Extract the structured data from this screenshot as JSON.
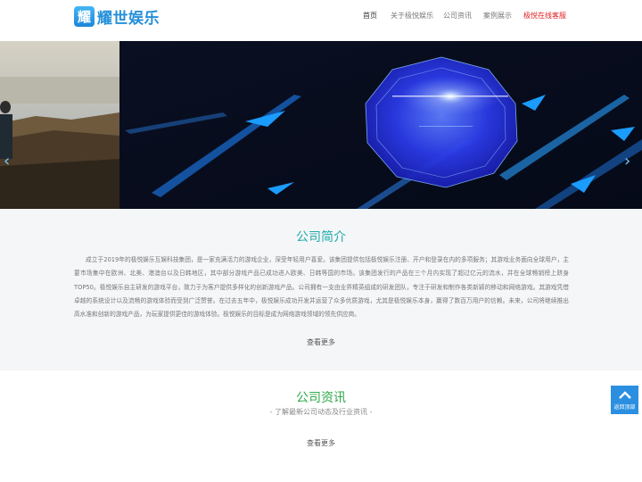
{
  "header": {
    "logo_mark": "耀",
    "logo_text": "耀世娱乐",
    "nav": [
      "首页",
      "关于极悦娱乐",
      "公司资讯",
      "案例展示",
      "极悦在线客服"
    ]
  },
  "banner": {
    "prev": "‹",
    "next": "›"
  },
  "about": {
    "title": "公司简介",
    "body": "成立于2019年的极悦娱乐互娱科技集团，是一家充满活力的游戏企业，深受年轻用户喜爱。该集团提供包括极悦娱乐注册、开户和登录在内的多项服务；其游戏业务面向全球用户，主要市场集中在欧洲、北美、港澳台以及日韩地区，其中部分游戏产品已成功进入欧美、日韩等国的市场。该集团发行的产品在三个月内实现了超过亿元的流水，并在全球畅销榜上跻身TOP50。极悦娱乐自主研发的游戏平台，致力于为客户提供多样化的创新游戏产品。公司拥有一支由业界精英组成的研发团队，专注于研发和制作各类新颖的移动和网络游戏。其游戏凭借卓越的系统设计以及流畅的游戏体验而受到广泛赞誉。在过去五年中，极悦娱乐成功开发并运营了众多优质游戏，尤其是极悦娱乐本身，赢得了数百万用户的信赖。未来，公司将继续推出高水准和创新的游戏产品，为玩家提供更佳的游戏体验。极悦娱乐的目标是成为网络游戏领域的领先供应商。",
    "more": "查看更多"
  },
  "news": {
    "title": "公司资讯",
    "subtitle": "- 了解最新公司动态及行业资讯 -",
    "more": "查看更多"
  },
  "backtop": {
    "label": "返回顶部"
  },
  "colors": {
    "brand": "#2590d9",
    "about_title": "#1eaaa8",
    "news_title": "#2ea84a",
    "hot_nav": "#e02020",
    "backtop": "#2a8fe0"
  }
}
